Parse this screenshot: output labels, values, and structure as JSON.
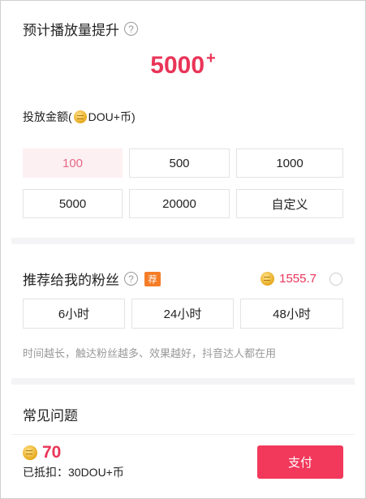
{
  "estimate": {
    "title": "预计播放量提升",
    "help_glyph": "?",
    "value": "5000",
    "plus": "+"
  },
  "amount": {
    "label_prefix": "投放金额(",
    "label_suffix": "DOU+币)",
    "options": [
      "100",
      "500",
      "1000",
      "5000",
      "20000",
      "自定义"
    ],
    "selected": "100"
  },
  "recommend": {
    "title": "推荐给我的粉丝",
    "help_glyph": "?",
    "tag": "荐",
    "balance": "1555.7",
    "durations": [
      "6小时",
      "24小时",
      "48小时"
    ],
    "hint": "时间越长，触达粉丝越多、效果越好，抖音达人都在用"
  },
  "faq": {
    "title": "常见问题"
  },
  "footer": {
    "total": "70",
    "deduct_label": "已抵扣：",
    "deduct_value": "30DOU+币",
    "pay_label": "支付"
  },
  "colors": {
    "accent": "#e93558",
    "pay_button": "#f2385b",
    "tag": "#f57d28",
    "selected_bg": "#fdf0f3"
  }
}
